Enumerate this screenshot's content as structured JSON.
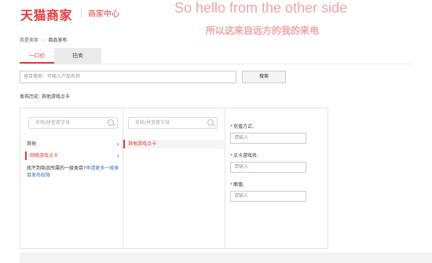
{
  "header": {
    "brand": "天猫商家",
    "subbrand": "商家中心"
  },
  "overlay": {
    "line1": "So hello from the other side",
    "line2": "所以这来自远方的我的来电"
  },
  "breadcrumb": {
    "home": "我是卖家",
    "separator": "›",
    "current": "商品发布"
  },
  "tabs": [
    {
      "label": "一口价",
      "active": true
    },
    {
      "label": "拍卖",
      "active": false
    }
  ],
  "search": {
    "placeholder": "类目搜索：可输入产品名称",
    "button_label": "搜索"
  },
  "history": {
    "text": "发布历史: 其他游戏点卡"
  },
  "category_columns": {
    "col1": {
      "search_placeholder": "名称/拼音首字母",
      "items": [
        {
          "label": "其他",
          "selected": false
        },
        {
          "label": "网络游戏点卡",
          "selected": true
        }
      ],
      "not_found_text": "找不到商品所属的一级类目?",
      "not_found_link": "申请更多一级类目发布权限"
    },
    "col2": {
      "search_placeholder": "名称/拼音首字母",
      "items": [
        {
          "label": "其他游戏点卡",
          "selected": false
        }
      ]
    }
  },
  "form": {
    "fields": [
      {
        "label": "充值方式:",
        "placeholder": "请输入",
        "required": true
      },
      {
        "label": "点卡游戏名:",
        "placeholder": "请输入",
        "required": true
      },
      {
        "label": "面值:",
        "placeholder": "请输入",
        "required": true
      }
    ]
  },
  "colors": {
    "brand_red": "#e4393c",
    "overlay_pink": "#f3a4a2",
    "link_blue": "#3a6ec4"
  }
}
